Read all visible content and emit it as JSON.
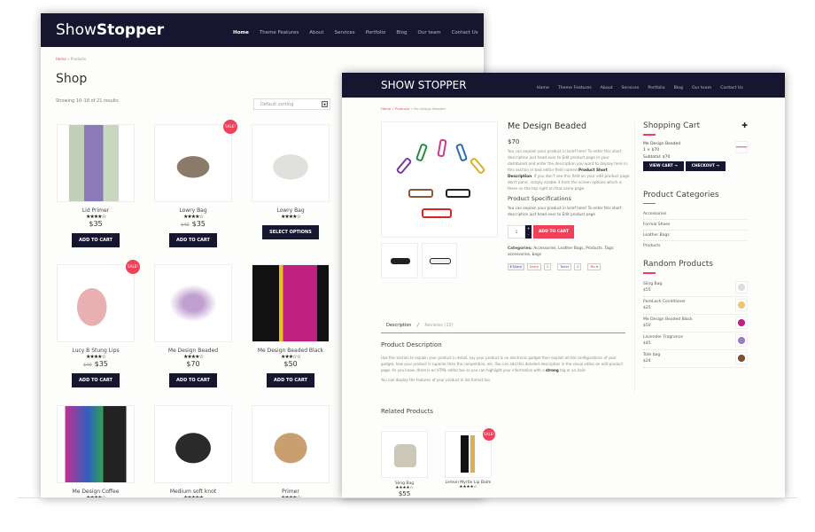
{
  "shop_page": {
    "logo_light": "Show",
    "logo_bold": "Stopper",
    "nav": [
      "Home",
      "Theme Features",
      "About",
      "Services",
      "Portfolio",
      "Blog",
      "Our team",
      "Contact Us"
    ],
    "breadcrumb": {
      "home": "Home",
      "sep": " » ",
      "current": "Products"
    },
    "title": "Shop",
    "result_count": "Showing 10–18 of 21 results",
    "sort": "Default sorting",
    "products": [
      {
        "name": "Lid Primer",
        "stars": "★★★★☆",
        "price": "$35",
        "old_price": "",
        "button": "ADD TO CART",
        "sale": ""
      },
      {
        "name": "Lowry Bag",
        "stars": "★★★★☆",
        "price": "$35",
        "old_price": "$40",
        "button": "ADD TO CART",
        "sale": "SALE!"
      },
      {
        "name": "Lowry Bag",
        "stars": "★★★★☆",
        "price": "",
        "old_price": "",
        "button": "SELECT OPTIONS",
        "sale": ""
      },
      {
        "name": "Lucy B Stung Lips",
        "stars": "★★★★☆",
        "price": "$35",
        "old_price": "$40",
        "button": "ADD TO CART",
        "sale": "SALE!"
      },
      {
        "name": "Me Design Beaded",
        "stars": "★★★★☆",
        "price": "$70",
        "old_price": "",
        "button": "ADD TO CART",
        "sale": ""
      },
      {
        "name": "Me Design Beaded Black",
        "stars": "★★★☆☆",
        "price": "$50",
        "old_price": "",
        "button": "ADD TO CART",
        "sale": ""
      },
      {
        "name": "Me Design Coffee",
        "stars": "★★★★☆",
        "price": "",
        "old_price": "",
        "button": "",
        "sale": ""
      },
      {
        "name": "Medium soft knot",
        "stars": "★★★★★",
        "price": "",
        "old_price": "",
        "button": "",
        "sale": ""
      },
      {
        "name": "Primer",
        "stars": "★★★★☆",
        "price": "",
        "old_price": "",
        "button": "",
        "sale": ""
      }
    ]
  },
  "product_page": {
    "logo": "SHOW STOPPER",
    "nav": [
      "Home",
      "Theme Features",
      "About",
      "Services",
      "Portfolio",
      "Blog",
      "Our team",
      "Contact Us"
    ],
    "breadcrumb": {
      "home": "Home",
      "products": "Products",
      "current": "Me Design Beaded",
      "sep": " » "
    },
    "title": "Me Design Beaded",
    "price": "$70",
    "short_desc_1": "You can explain your product in brief here! To enter this short description just head over to Edit product page in your dashboard and enter the description you want to display here in this section in text editor field named ",
    "short_desc_bold": "Product Short Description",
    "short_desc_2": ". If you don't see this field on your edit product page don't panic, simply enable it from the screen options which is there on the top right on that same page.",
    "spec_heading": "Product Specifications",
    "spec_text": "You can explain your product in brief here! To enter this short description just head over to Edit product page",
    "quantity": "1",
    "add_to_cart": "ADD TO CART",
    "categories_label": "Categories:",
    "categories": "Accessories, Leather Bags, Products.",
    "tags_label": "Tags:",
    "tags": "accessories, bags",
    "share": {
      "fb": "Share",
      "gplus": "Share",
      "gplus_count": "1",
      "tweet": "Tweet",
      "tweet_count": "0",
      "pin": "Pin it"
    },
    "tabs": {
      "description": "Description",
      "sep": "/",
      "reviews": "Reviews (10)"
    },
    "desc_heading": "Product Description",
    "desc_1": "Use this section to explain your product in detail, say your product is an electronic gadget then explain all the configurations of your gadget, how your product is superior then the competition, etc. You can add this detailed description in the visual editor on edit product page. As you know, there is an HTML editor too so you can highlight your information with a ",
    "desc_strong": "strong",
    "desc_2": " tag or an ",
    "desc_italic": "italic",
    "desc_3": "You can display the features of your product in list format too.",
    "related_heading": "Related Products",
    "related": [
      {
        "name": "Sling Bag",
        "stars": "★★★★☆",
        "price": "$55",
        "sale": ""
      },
      {
        "name": "Lemon Myrtle Lip Balm",
        "stars": "★★★★☆",
        "price": "",
        "sale": "SALE!"
      }
    ],
    "sidebar": {
      "cart_heading": "Shopping Cart",
      "cart_item": "Me Design Beaded",
      "cart_qty": "1 × $70",
      "subtotal": "Subtotal: $70",
      "view_cart": "VIEW CART →",
      "checkout": "CHECKOUT →",
      "cat_heading": "Product Categories",
      "categories": [
        "Accessories",
        "Formal Shoes",
        "Leather Bags",
        "Products"
      ],
      "random_heading": "Random Products",
      "random": [
        {
          "name": "Sling Bag",
          "price": "$55"
        },
        {
          "name": "PureLash Conditioner",
          "price": "$25"
        },
        {
          "name": "Me Design Beaded Black",
          "price": "$50"
        },
        {
          "name": "Lavender Fragrance",
          "price": "$45"
        },
        {
          "name": "Tote bag",
          "price": "$24"
        }
      ]
    }
  },
  "colors": {
    "header": "#161630",
    "accent": "#f0405a"
  }
}
